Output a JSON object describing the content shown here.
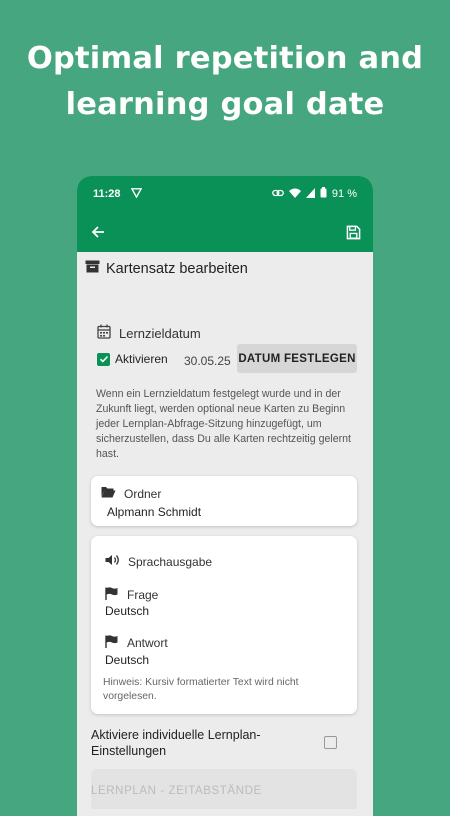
{
  "headline": {
    "line1": "Optimal repetition and",
    "line2": "learning goal date"
  },
  "status_bar": {
    "time": "11:28",
    "battery": "91 %"
  },
  "app_bar": {
    "back_icon": "arrow-left-icon",
    "save_icon": "floppy-disk-icon"
  },
  "screen": {
    "title": "Kartensatz bearbeiten",
    "title_icon": "archive-box-icon",
    "goal": {
      "label": "Lernzieldatum",
      "activate_label": "Aktivieren",
      "activated": true,
      "date": "30.05.25",
      "set_date_button": "DATUM FESTLEGEN",
      "description": "Wenn ein Lernzieldatum festgelegt wurde und in der Zukunft liegt, werden optional neue Karten zu Beginn jeder Lernplan-Abfrage-Sitzung hinzugefügt, um sicherzustellen, dass Du alle Karten rechtzeitig gelernt hast."
    },
    "folder": {
      "label": "Ordner",
      "value": "Alpmann Schmidt"
    },
    "speech": {
      "label": "Sprachausgabe",
      "question_label": "Frage",
      "question_value": "Deutsch",
      "answer_label": "Antwort",
      "answer_value": "Deutsch",
      "hint": "Hinweis: Kursiv formatierter Text wird nicht vorgelesen."
    },
    "individual_settings": {
      "label": "Aktiviere individuelle Lernplan-Einstellungen",
      "checked": false
    },
    "section_label": "LERNPLAN - ZEITABSTÄNDE"
  },
  "colors": {
    "background": "#46a67f",
    "app_bar": "#0a9158",
    "screen_bg": "#ececec"
  }
}
